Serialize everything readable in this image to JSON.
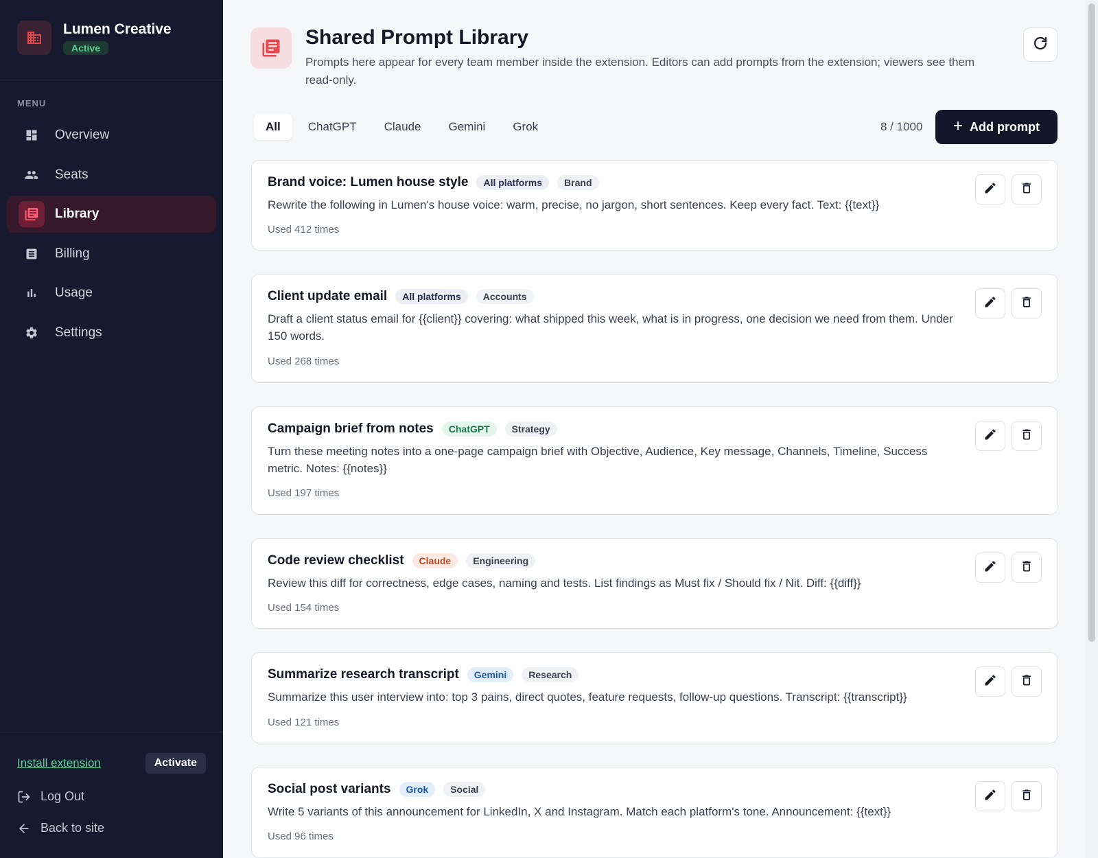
{
  "sidebar": {
    "brand_name": "Lumen Creative",
    "brand_status": "Active",
    "menu_label": "MENU",
    "items": [
      {
        "label": "Overview",
        "icon": "dashboard-icon"
      },
      {
        "label": "Seats",
        "icon": "people-icon"
      },
      {
        "label": "Library",
        "icon": "library-icon",
        "active": true
      },
      {
        "label": "Billing",
        "icon": "receipt-icon"
      },
      {
        "label": "Usage",
        "icon": "bar-chart-icon"
      },
      {
        "label": "Settings",
        "icon": "gear-icon"
      }
    ],
    "install_label": "Install extension",
    "activate_label": "Activate",
    "logout_label": "Log Out",
    "back_label": "Back to site"
  },
  "header": {
    "title": "Shared Prompt Library",
    "description": "Prompts here appear for every team member inside the extension. Editors can add prompts from the extension; viewers see them read-only."
  },
  "tabs": [
    "All",
    "ChatGPT",
    "Claude",
    "Gemini",
    "Grok"
  ],
  "active_tab": "All",
  "count": "8 / 1000",
  "add_label": "Add prompt",
  "prompts": [
    {
      "title": "Brand voice: Lumen house style",
      "platform": "All platforms",
      "tag": "Brand",
      "text": "Rewrite the following in Lumen's house voice: warm, precise, no jargon, short sentences. Keep every fact. Text: {{text}}",
      "used": "Used 412 times"
    },
    {
      "title": "Client update email",
      "platform": "All platforms",
      "tag": "Accounts",
      "text": "Draft a client status email for {{client}} covering: what shipped this week, what is in progress, one decision we need from them. Under 150 words.",
      "used": "Used 268 times"
    },
    {
      "title": "Campaign brief from notes",
      "platform": "ChatGPT",
      "tag": "Strategy",
      "text": "Turn these meeting notes into a one-page campaign brief with Objective, Audience, Key message, Channels, Timeline, Success metric. Notes: {{notes}}",
      "used": "Used 197 times"
    },
    {
      "title": "Code review checklist",
      "platform": "Claude",
      "tag": "Engineering",
      "text": "Review this diff for correctness, edge cases, naming and tests. List findings as Must fix / Should fix / Nit. Diff: {{diff}}",
      "used": "Used 154 times"
    },
    {
      "title": "Summarize research transcript",
      "platform": "Gemini",
      "tag": "Research",
      "text": "Summarize this user interview into: top 3 pains, direct quotes, feature requests, follow-up questions. Transcript: {{transcript}}",
      "used": "Used 121 times"
    },
    {
      "title": "Social post variants",
      "platform": "Grok",
      "tag": "Social",
      "text": "Write 5 variants of this announcement for LinkedIn, X and Instagram. Match each platform's tone. Announcement: {{text}}",
      "used": "Used 96 times"
    }
  ],
  "colors": {
    "sidebar_bg": "#171a2e",
    "accent": "#e5484d",
    "active_green": "#5ad39a",
    "primary_button": "#121628"
  }
}
